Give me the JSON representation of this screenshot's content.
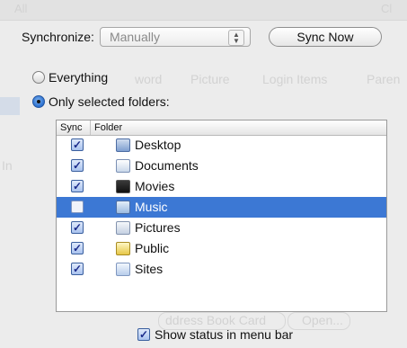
{
  "background_ghost": {
    "top_left": "All",
    "top_right": "Cl",
    "tabs": [
      "word",
      "Picture",
      "Login Items",
      "Paren"
    ],
    "left_partial": "In",
    "address_book_button": "ddress Book Card",
    "open_button": "Open..."
  },
  "sync": {
    "label": "Synchronize:",
    "mode_value": "Manually",
    "sync_now_label": "Sync Now"
  },
  "scope": {
    "everything_label": "Everything",
    "only_selected_label": "Only selected folders:",
    "selected": "Only selected folders:"
  },
  "folders_table": {
    "headers": {
      "sync": "Sync",
      "folder": "Folder"
    },
    "rows": [
      {
        "name": "Desktop",
        "checked": true,
        "selected": false,
        "icon": "desktop-folder-icon"
      },
      {
        "name": "Documents",
        "checked": true,
        "selected": false,
        "icon": "documents-folder-icon"
      },
      {
        "name": "Movies",
        "checked": true,
        "selected": false,
        "icon": "movies-folder-icon"
      },
      {
        "name": "Music",
        "checked": false,
        "selected": true,
        "icon": "music-folder-icon"
      },
      {
        "name": "Pictures",
        "checked": true,
        "selected": false,
        "icon": "pictures-folder-icon"
      },
      {
        "name": "Public",
        "checked": true,
        "selected": false,
        "icon": "public-folder-icon"
      },
      {
        "name": "Sites",
        "checked": true,
        "selected": false,
        "icon": "sites-folder-icon"
      }
    ]
  },
  "status_menu": {
    "label": "Show status in menu bar",
    "checked": true
  },
  "colors": {
    "selection": "#3c78d4",
    "window_bg": "#ececec",
    "checkmark": "#1a2a8a"
  }
}
